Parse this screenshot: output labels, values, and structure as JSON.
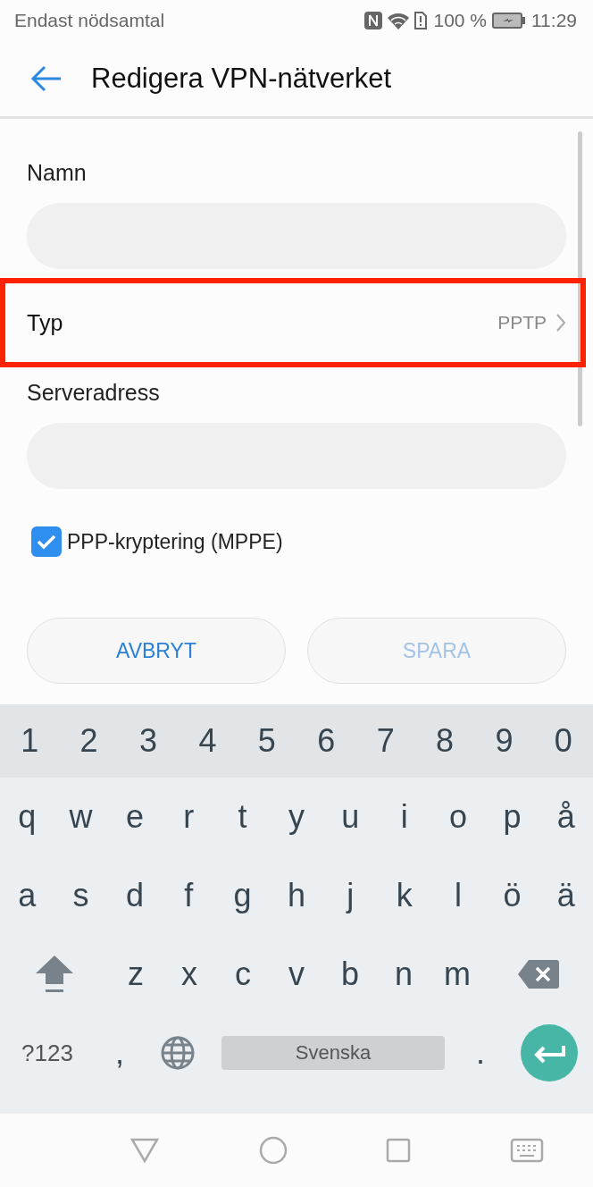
{
  "status_bar": {
    "carrier": "Endast nödsamtal",
    "battery": "100 %",
    "time": "11:29"
  },
  "app_bar": {
    "title": "Redigera VPN-nätverket"
  },
  "form": {
    "name": {
      "label": "Namn"
    },
    "type": {
      "label": "Typ",
      "value": "PPTP",
      "highlighted": true
    },
    "server": {
      "label": "Serveradress"
    },
    "encryption": {
      "label": "PPP-kryptering (MPPE)",
      "checked": true
    }
  },
  "buttons": [
    {
      "label": "AVBRYT",
      "disabled": false
    },
    {
      "label": "SPARA",
      "disabled": true
    }
  ],
  "keyboard": {
    "number_row": [
      "1",
      "2",
      "3",
      "4",
      "5",
      "6",
      "7",
      "8",
      "9",
      "0"
    ],
    "top_row": [
      "q",
      "w",
      "e",
      "r",
      "t",
      "y",
      "u",
      "i",
      "o",
      "p",
      "å"
    ],
    "home_row": [
      "a",
      "s",
      "d",
      "f",
      "g",
      "h",
      "j",
      "k",
      "l",
      "ö",
      "ä"
    ],
    "bottom_row": [
      {
        "kind": "shift"
      },
      {
        "kind": "char",
        "label": "z"
      },
      {
        "kind": "char",
        "label": "x"
      },
      {
        "kind": "char",
        "label": "c"
      },
      {
        "kind": "char",
        "label": "v"
      },
      {
        "kind": "char",
        "label": "b"
      },
      {
        "kind": "char",
        "label": "n"
      },
      {
        "kind": "char",
        "label": "m"
      },
      {
        "kind": "backspace"
      }
    ],
    "function_row": [
      {
        "kind": "symbols",
        "label": "?123"
      },
      {
        "kind": "comma",
        "label": ","
      },
      {
        "kind": "globe"
      },
      {
        "kind": "space",
        "label": "Svenska"
      },
      {
        "kind": "period",
        "label": "."
      },
      {
        "kind": "enter"
      }
    ]
  }
}
